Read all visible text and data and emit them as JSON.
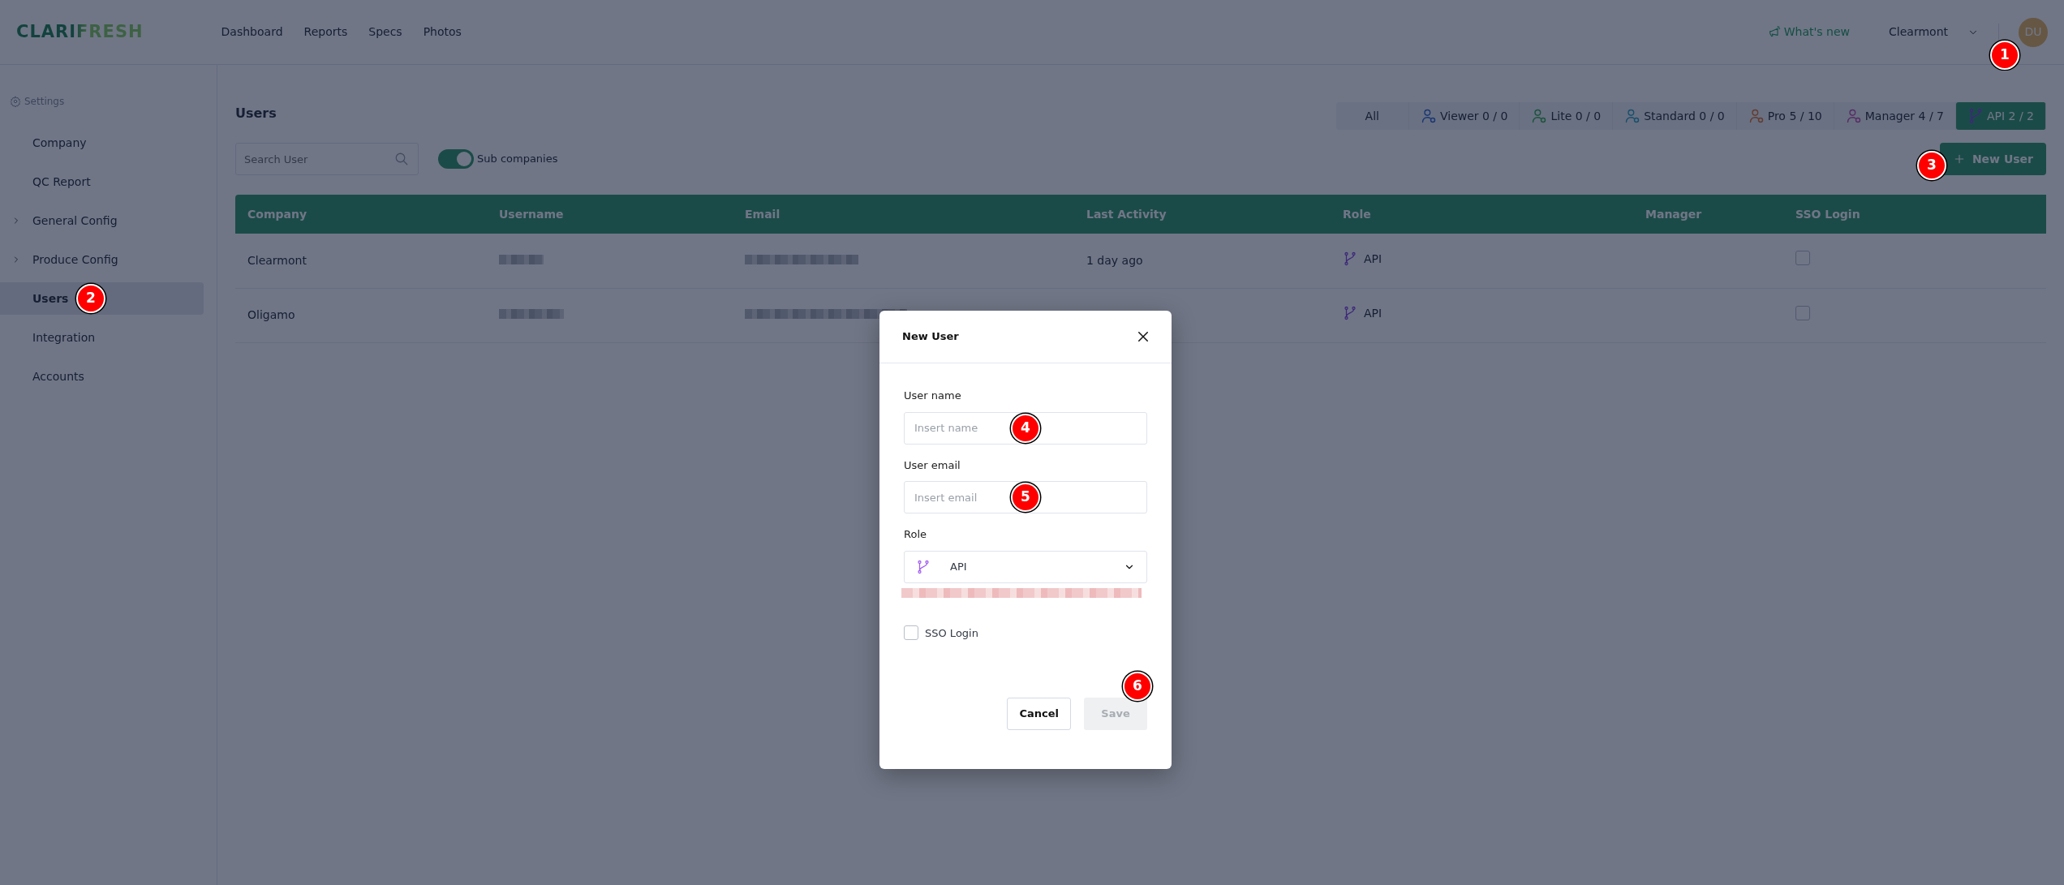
{
  "topbar": {
    "logo": "CLARIFRESH",
    "nav": [
      {
        "label": "Dashboard",
        "selected": false
      },
      {
        "label": "Reports",
        "selected": false
      },
      {
        "label": "Specs",
        "selected": false
      },
      {
        "label": "Photos",
        "selected": false
      }
    ],
    "whats_new": "What's new",
    "company_select": "Clearmont",
    "avatar": {
      "initials": "DU",
      "callout": "1"
    }
  },
  "sidebar": {
    "header": "Settings",
    "items": [
      {
        "label": "Company",
        "expandable": false,
        "selected": false
      },
      {
        "label": "QC Report",
        "expandable": false,
        "selected": false
      },
      {
        "label": "General Config",
        "expandable": true,
        "selected": false
      },
      {
        "label": "Produce Config",
        "expandable": true,
        "selected": false
      },
      {
        "label": "Users",
        "expandable": false,
        "selected": true,
        "callout": "2"
      },
      {
        "label": "Integration",
        "expandable": false,
        "selected": false
      },
      {
        "label": "Accounts",
        "expandable": false,
        "selected": false
      }
    ]
  },
  "main": {
    "title": "Users",
    "role_filters": [
      {
        "label": "All",
        "kind": "none",
        "selected": false
      },
      {
        "label": "Viewer 0 / 0",
        "kind": "viewer",
        "selected": false
      },
      {
        "label": "Lite 0 / 0",
        "kind": "lite",
        "selected": false
      },
      {
        "label": "Standard 0 / 0",
        "kind": "standard",
        "selected": false
      },
      {
        "label": "Pro 5 / 10",
        "kind": "pro",
        "selected": false
      },
      {
        "label": "Manager 4 / 7",
        "kind": "manager",
        "selected": false
      },
      {
        "label": "API 2 / 2",
        "kind": "api",
        "selected": true
      }
    ],
    "search": {
      "placeholder": "Search User"
    },
    "sub_companies": {
      "label": "Sub companies",
      "on": true
    },
    "new_user_button": {
      "label": "New User",
      "callout": "3"
    },
    "table": {
      "columns": [
        "Company",
        "Username",
        "Email",
        "Last Activity",
        "Role",
        "Manager",
        "SSO Login"
      ],
      "rows": [
        {
          "company": "Clearmont",
          "username_blurred": true,
          "email_blurred": true,
          "last_activity": "1 day ago",
          "role": "API",
          "sso_login": false
        },
        {
          "company": "Oligamo",
          "username_blurred": true,
          "email_blurred": true,
          "role": "API",
          "sso_login": false
        }
      ]
    }
  },
  "modal": {
    "title": "New User",
    "fields": [
      {
        "label": "User name",
        "placeholder": "Insert name",
        "callout": "4"
      },
      {
        "label": "User email",
        "placeholder": "Insert email",
        "callout": "5"
      }
    ],
    "role": {
      "label": "Role",
      "value": "API",
      "error_blurred": true
    },
    "sso_login": {
      "label": "SSO Login",
      "checked": false
    },
    "buttons": [
      {
        "label": "Cancel",
        "kind": "secondary",
        "disabled": false
      },
      {
        "label": "Save",
        "kind": "primary",
        "disabled": true,
        "callout": "6"
      }
    ]
  }
}
